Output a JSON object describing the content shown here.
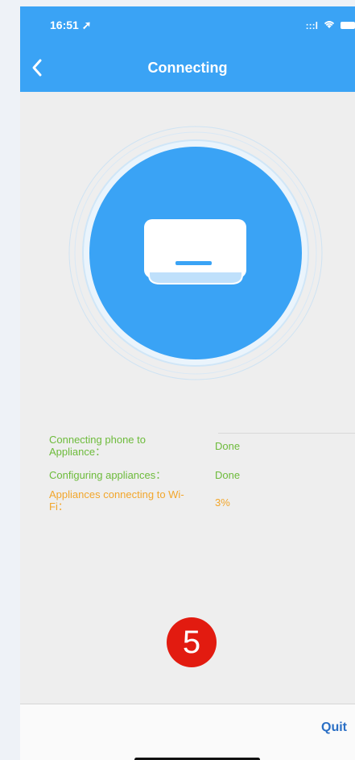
{
  "status_bar": {
    "time": "16:51",
    "signal_text": ":::l"
  },
  "navbar": {
    "title": "Connecting"
  },
  "steps": [
    {
      "label": "Connecting phone to Appliance：",
      "status": "Done",
      "state": "done"
    },
    {
      "label": "Configuring appliances：",
      "status": "Done",
      "state": "done"
    },
    {
      "label": "Appliances connecting to Wi-Fi：",
      "status": "3%",
      "state": "active"
    }
  ],
  "progress_percent": 3,
  "step_badge": "5",
  "footer": {
    "quit_label": "Quit"
  },
  "colors": {
    "primary": "#3aa3f5",
    "done": "#6dbb3b",
    "active": "#f2a62b",
    "badge": "#e21b10",
    "quit": "#2a6fc5"
  }
}
